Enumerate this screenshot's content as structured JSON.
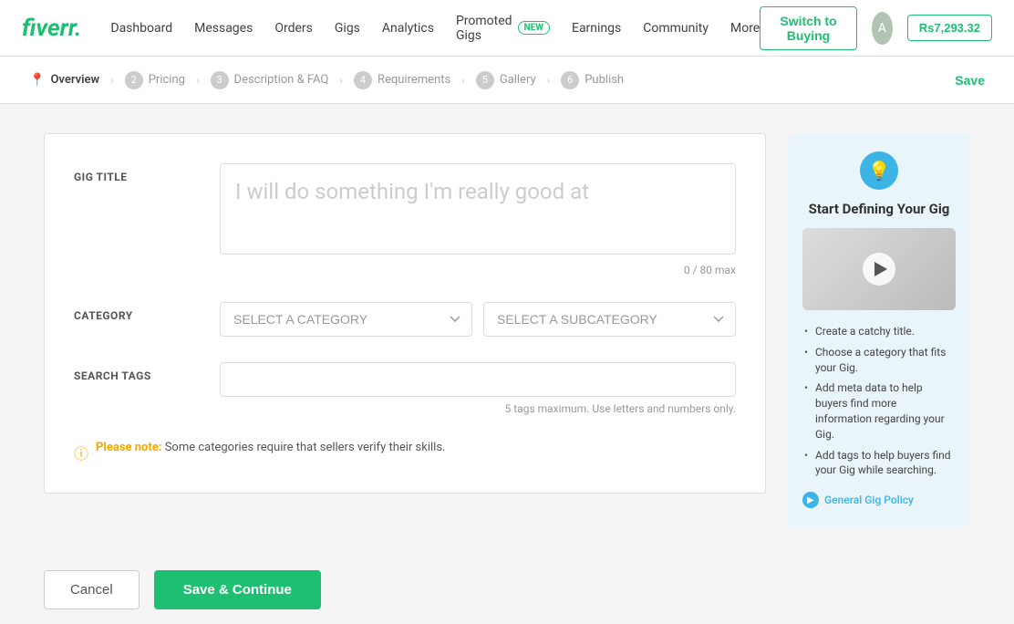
{
  "header": {
    "logo": "fiverr.",
    "nav": [
      {
        "label": "Dashboard",
        "id": "dashboard"
      },
      {
        "label": "Messages",
        "id": "messages"
      },
      {
        "label": "Orders",
        "id": "orders"
      },
      {
        "label": "Gigs",
        "id": "gigs"
      },
      {
        "label": "Analytics",
        "id": "analytics"
      },
      {
        "label": "Promoted Gigs",
        "id": "promoted-gigs"
      },
      {
        "label": "NEW",
        "id": "new-badge"
      },
      {
        "label": "Earnings",
        "id": "earnings"
      },
      {
        "label": "Community",
        "id": "community"
      },
      {
        "label": "More",
        "id": "more"
      }
    ],
    "switch_buying_label": "Switch to Buying",
    "balance": "Rs7,293.32",
    "avatar_initial": "A"
  },
  "breadcrumb": {
    "save_label": "Save",
    "steps": [
      {
        "num": "1",
        "label": "Overview",
        "active": true,
        "icon": true
      },
      {
        "num": "2",
        "label": "Pricing",
        "active": false
      },
      {
        "num": "3",
        "label": "Description & FAQ",
        "active": false
      },
      {
        "num": "4",
        "label": "Requirements",
        "active": false
      },
      {
        "num": "5",
        "label": "Gallery",
        "active": false
      },
      {
        "num": "6",
        "label": "Publish",
        "active": false
      }
    ]
  },
  "form": {
    "gig_title_label": "GIG TITLE",
    "gig_title_placeholder": "I will do something I'm really good at",
    "char_count": "0 / 80 max",
    "category_label": "CATEGORY",
    "category_placeholder": "SELECT A CATEGORY",
    "subcategory_placeholder": "SELECT A SUBCATEGORY",
    "search_tags_label": "SEARCH TAGS",
    "search_tags_placeholder": "",
    "tags_hint": "5 tags maximum. Use letters and numbers only.",
    "please_note_label": "Please note:",
    "please_note_text": "Some categories require that sellers verify their skills."
  },
  "sidebar": {
    "title": "Start Defining Your Gig",
    "tips": [
      "Create a catchy title.",
      "Choose a category that fits your Gig.",
      "Add meta data to help buyers find more information regarding your Gig.",
      "Add tags to help buyers find your Gig while searching."
    ],
    "policy_label": "General Gig Policy"
  },
  "footer": {
    "cancel_label": "Cancel",
    "save_continue_label": "Save & Continue"
  }
}
